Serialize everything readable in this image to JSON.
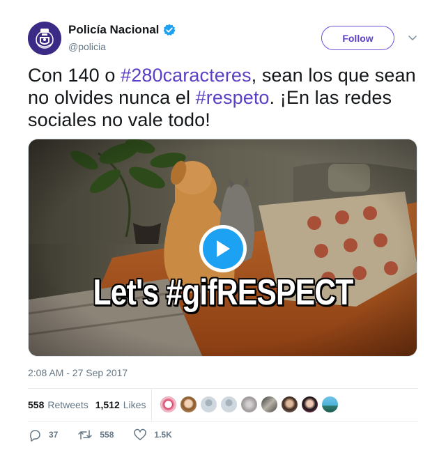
{
  "author": {
    "display_name": "Policía Nacional",
    "handle": "@policia",
    "verified": true,
    "avatar_icon": "police-badge-icon"
  },
  "follow_label": "Follow",
  "tweet": {
    "part1": "Con 140 o ",
    "hashtag1": "#280caracteres",
    "part2": ", sean los que sean no olvides nunca el ",
    "hashtag2": "#respeto",
    "part3": ". ¡En las redes sociales no vale todo!"
  },
  "media": {
    "caption": "Let's #gifRESPECT",
    "play_icon": "play-icon"
  },
  "timestamp": "2:08 AM - 27 Sep 2017",
  "stats": {
    "retweets_count": "558",
    "retweets_label": "Retweets",
    "likes_count": "1,512",
    "likes_label": "Likes"
  },
  "actions": {
    "reply_count": "37",
    "retweet_count": "558",
    "like_count": "1.5K"
  },
  "colors": {
    "accent": "#5b3fc4",
    "verified": "#1da1f2",
    "muted": "#657786"
  }
}
